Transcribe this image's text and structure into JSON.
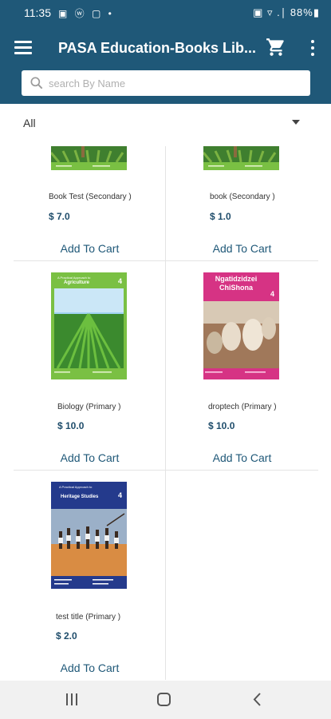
{
  "status_bar": {
    "time": "11:35",
    "left_icons": "▣ ⓦ ▢ •",
    "right_text": "▣ ▿ .∣ 88%▮"
  },
  "app": {
    "title": "PASA Education-Books Lib...",
    "brand_color": "#1f5878"
  },
  "search": {
    "placeholder": "search By Name",
    "value": ""
  },
  "filter": {
    "selected": "All"
  },
  "books": [
    {
      "name": "Book Test (Secondary )",
      "price": "$ 7.0",
      "add_label": "Add To Cart",
      "cover_icon": "agriculture-cover"
    },
    {
      "name": "book  (Secondary )",
      "price": "$ 1.0",
      "add_label": "Add To Cart",
      "cover_icon": "agriculture-cover"
    },
    {
      "name": "Biology (Primary )",
      "price": "$ 10.0",
      "add_label": "Add To Cart",
      "cover_icon": "agriculture-cover",
      "cover_text": {
        "title_small": "A Practical Approach to",
        "title_big": "Agriculture",
        "grade": "4"
      }
    },
    {
      "name": "droptech (Primary )",
      "price": "$ 10.0",
      "add_label": "Add To Cart",
      "cover_icon": "chishona-cover",
      "cover_text": {
        "title_big": "Ngatidzidzei ChiShona",
        "grade": "4"
      }
    },
    {
      "name": "test title (Primary )",
      "price": "$ 2.0",
      "add_label": "Add To Cart",
      "cover_icon": "heritage-cover",
      "cover_text": {
        "title_small": "A Practical Approach to",
        "title_big": "Heritage Studies",
        "grade": "4"
      }
    }
  ]
}
